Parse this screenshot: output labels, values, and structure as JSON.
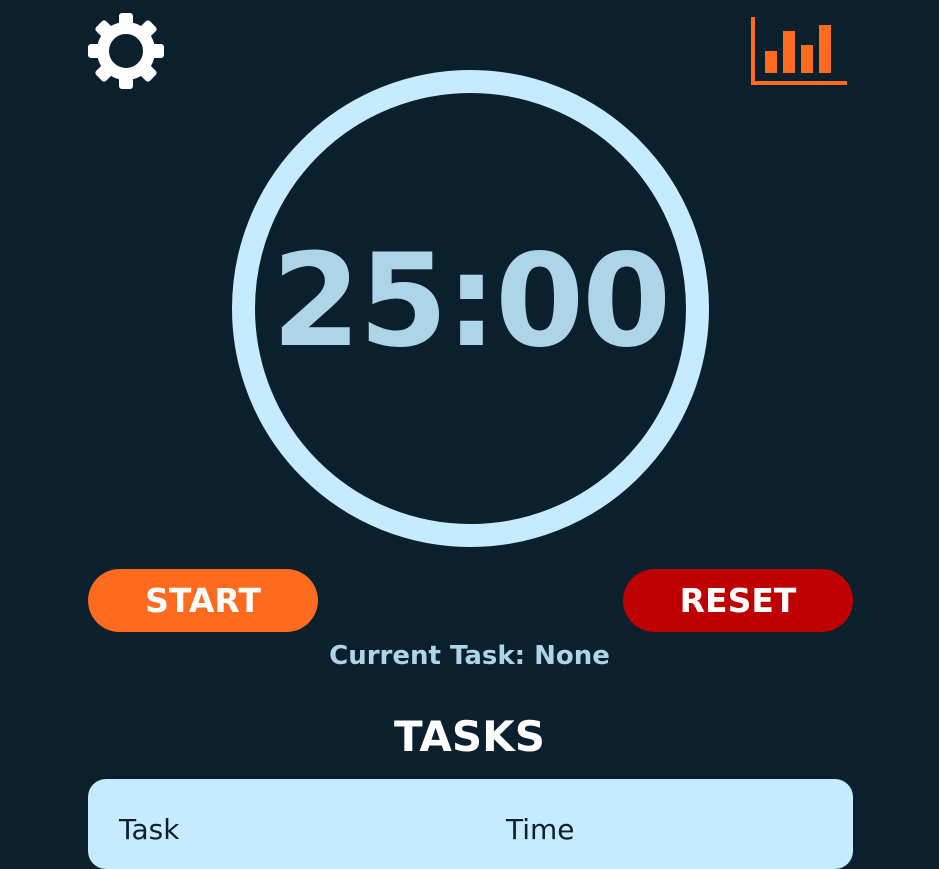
{
  "toolbar": {
    "settings_icon": "gear-icon",
    "stats_icon": "bar-chart-icon"
  },
  "timer": {
    "display": "25:00"
  },
  "controls": {
    "start_label": "START",
    "reset_label": "RESET"
  },
  "status": {
    "current_task": "Current Task: None"
  },
  "tasks": {
    "heading": "TASKS",
    "columns": [
      "Task",
      "Time"
    ]
  },
  "colors": {
    "background": "#0a212d",
    "ring": "#c6eaff",
    "timer_text": "#aed5e7",
    "start": "#fe6b1e",
    "reset": "#bf0000",
    "stats_icon": "#fe6b1e",
    "panel": "#c6eaff"
  }
}
